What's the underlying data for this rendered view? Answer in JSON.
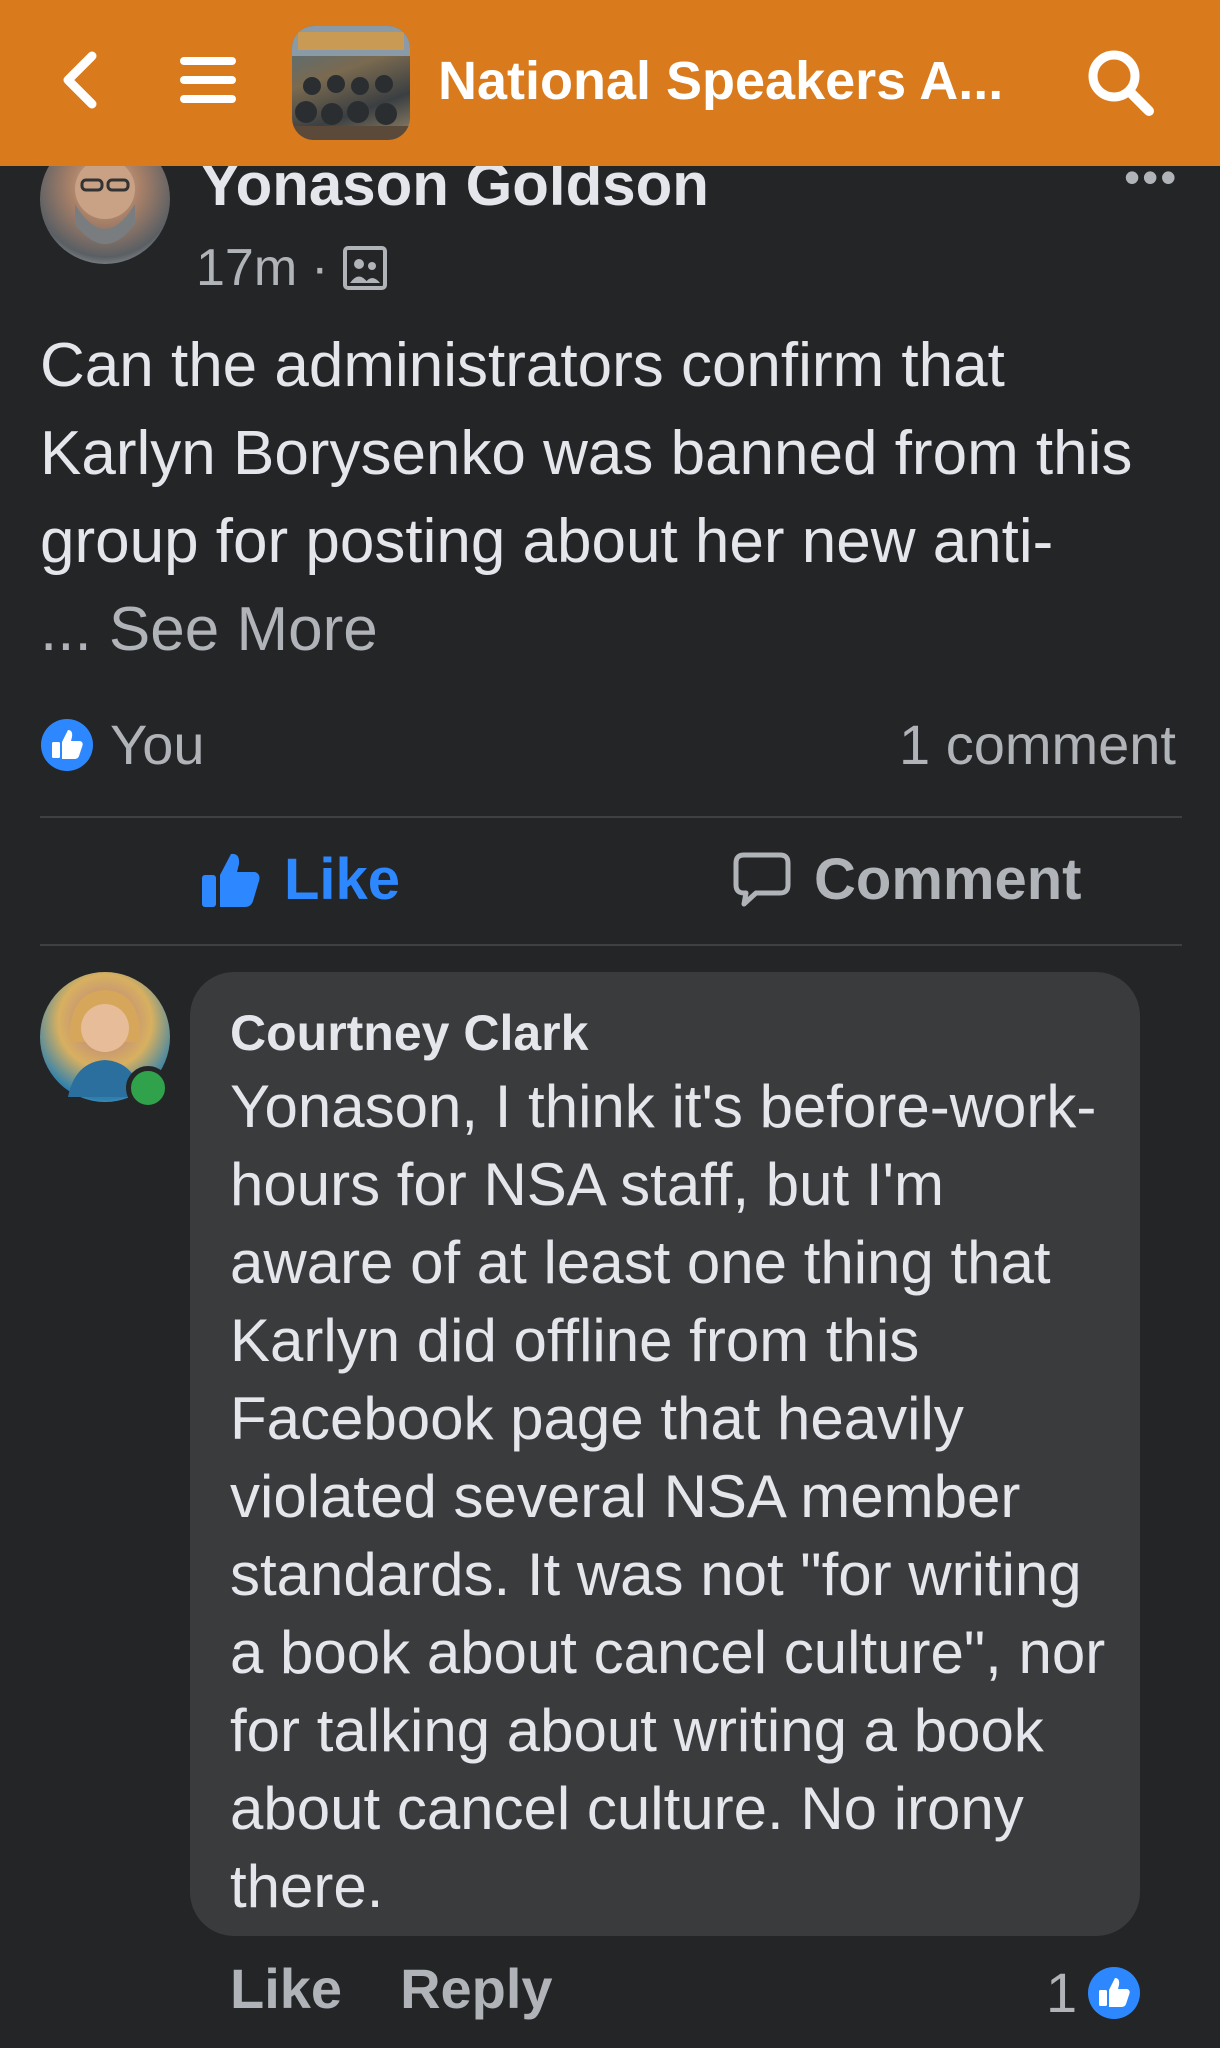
{
  "header": {
    "group_title": "National Speakers A...",
    "background_color": "#d97a1c"
  },
  "post": {
    "author": "Yonason Goldson",
    "time": "17m",
    "separator": "·",
    "audience_icon": "group-audience-icon",
    "body": "Can the administrators confirm that Karlyn Borysenko  was banned from this group for posting about her new anti-",
    "see_more": "... See More",
    "reactors": "You",
    "comment_count": "1 comment",
    "actions": {
      "like": "Like",
      "comment": "Comment"
    },
    "like_color": "#2d88ff"
  },
  "comment": {
    "author": "Courtney Clark",
    "text": "Yonason, I think it's before-work-hours for NSA staff, but I'm aware of at least one thing that Karlyn did offline from this Facebook page that heavily violated several NSA member standards. It was not \"for writing a book about cancel culture\", nor for talking about writing a book about cancel culture. No irony there.",
    "actions": {
      "like": "Like",
      "reply": "Reply"
    },
    "reaction_count": "1",
    "online_color": "#31a24c"
  }
}
